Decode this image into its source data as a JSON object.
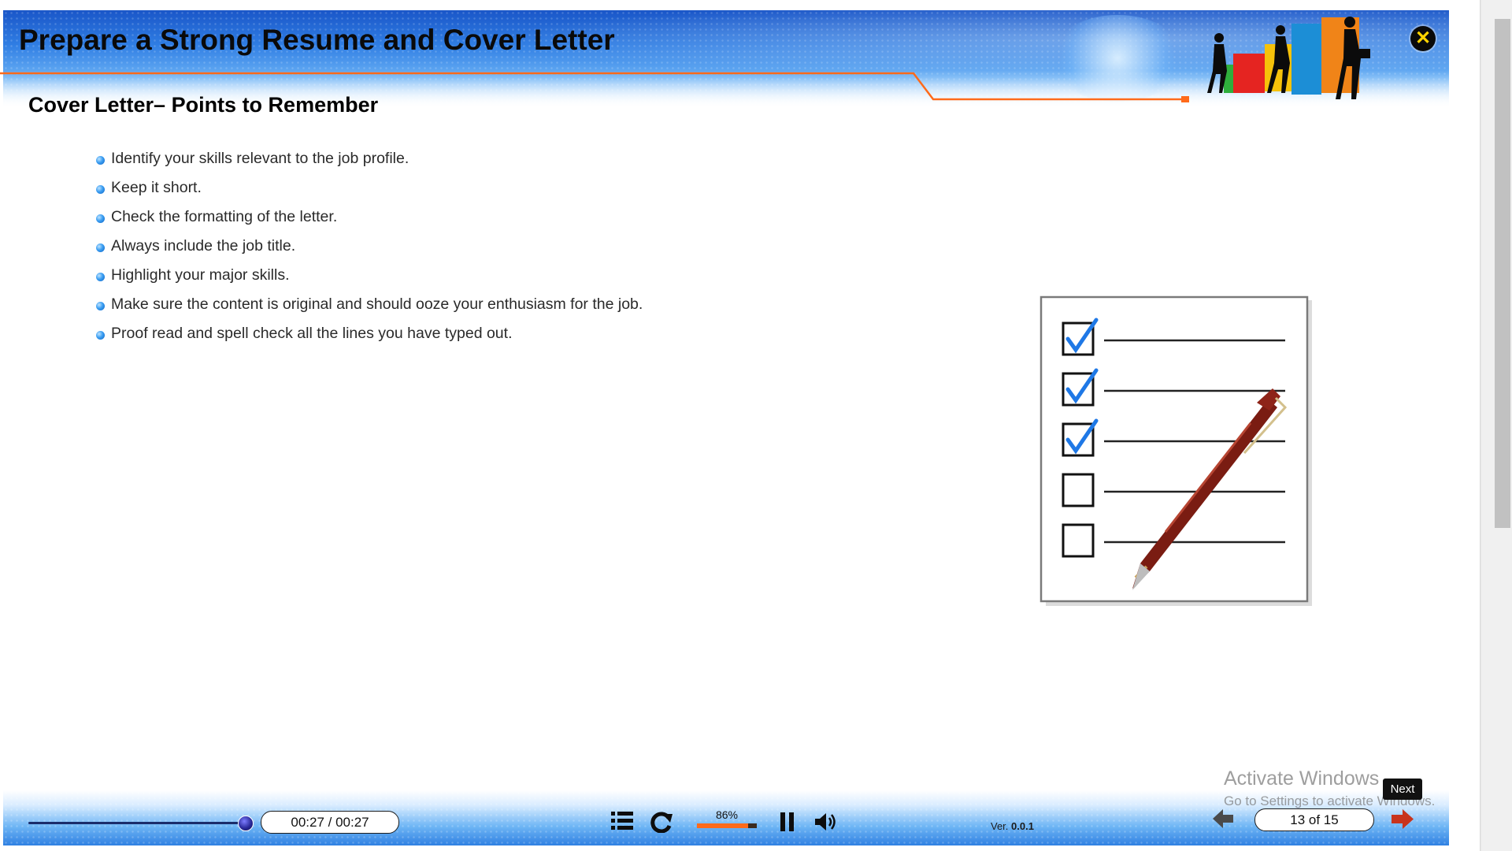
{
  "header": {
    "course_title": "Prepare a Strong Resume and Cover Letter",
    "close_icon": "close-icon"
  },
  "slide": {
    "title": "Cover Letter– Points to Remember",
    "bullets": [
      "Identify your skills relevant to the job profile.",
      "Keep it short.",
      "Check the formatting of the letter.",
      "Always include the job title.",
      "Highlight your major skills.",
      "Make sure the content is original and should ooze your enthusiasm for the job.",
      "Proof read and spell check all the lines you have typed out."
    ],
    "checklist": {
      "total_items": 5,
      "checked_items": 3
    }
  },
  "controls": {
    "seek_progress": 1.0,
    "time_display": "00:27 / 00:27",
    "toc_icon": "list-icon",
    "replay_icon": "replay-icon",
    "volume_label": "86%",
    "volume_level": 0.86,
    "pause_icon": "pause-icon",
    "sound_icon": "speaker-icon",
    "version_prefix": "Ver.",
    "version_number": "0.0.1",
    "prev_icon": "arrow-left-icon",
    "page_display": "13 of 15",
    "next_icon": "arrow-right-icon",
    "next_tooltip": "Next"
  },
  "os_watermark": {
    "line1": "Activate Windows",
    "line2": "Go to Settings to activate Windows."
  },
  "colors": {
    "header_blue": "#2f7de3",
    "accent_orange": "#ff6a1a",
    "bullet_blue": "#3b9ef2",
    "check_blue": "#1e78e6"
  }
}
